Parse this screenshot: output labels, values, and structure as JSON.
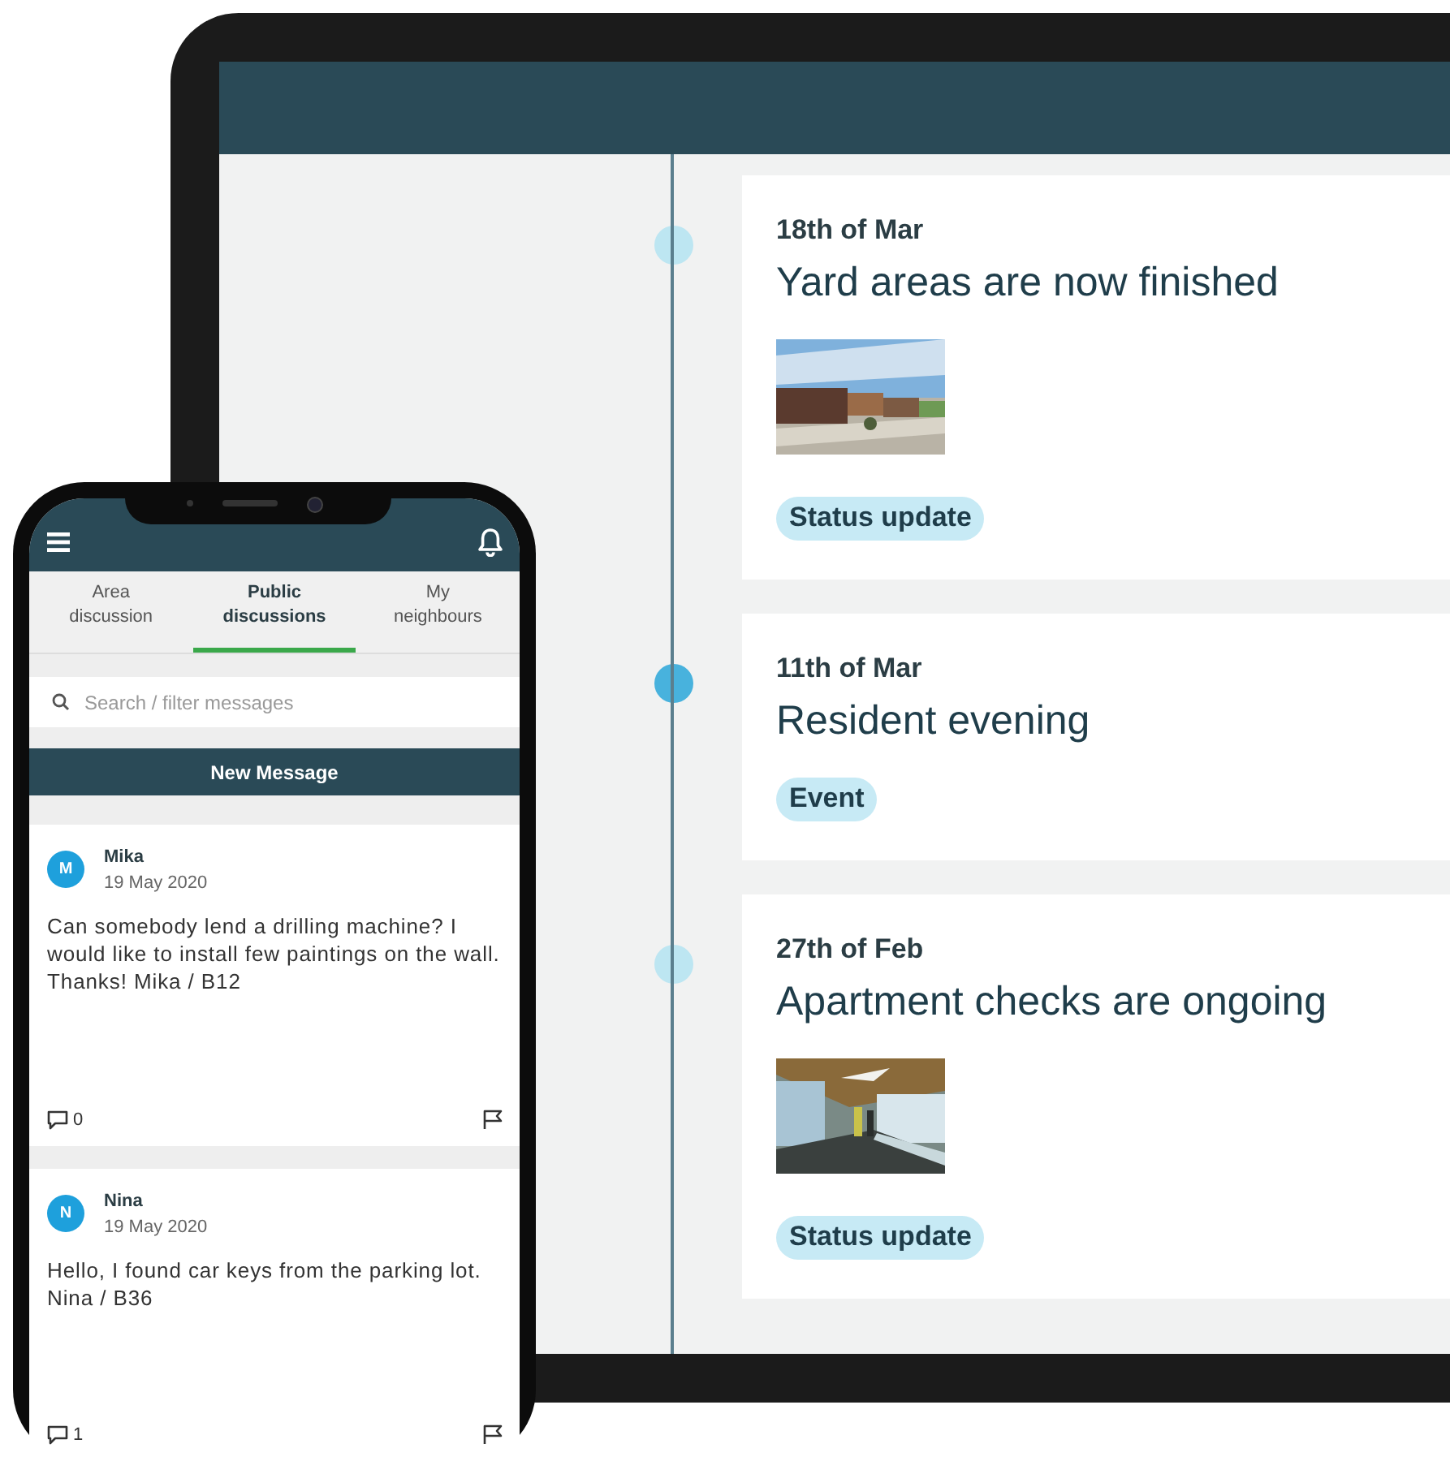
{
  "tablet": {
    "timeline": [
      {
        "date": "18th of Mar",
        "title": "Yard areas are now finished",
        "tag": "Status update",
        "highlighted": false
      },
      {
        "date": "11th of Mar",
        "title": "Resident evening",
        "tag": "Event",
        "highlighted": true
      },
      {
        "date": "27th of Feb",
        "title": "Apartment checks are ongoing",
        "tag": "Status update",
        "highlighted": false
      }
    ]
  },
  "phone": {
    "tabs": [
      {
        "label": "Area discussion",
        "selected": false
      },
      {
        "label": "Public discussions",
        "selected": true
      },
      {
        "label": "My neighbours",
        "selected": false
      }
    ],
    "search": {
      "placeholder": "Search / filter messages"
    },
    "new_message_button": "New Message",
    "messages": [
      {
        "initial": "M",
        "author": "Mika",
        "date": "19 May 2020",
        "text": "Can somebody lend a drilling machine? I would like to install few paintings on the wall. Thanks! Mika / B12",
        "comments": "0"
      },
      {
        "initial": "N",
        "author": "Nina",
        "date": "19 May 2020",
        "text": "Hello, I found car keys from the parking lot. Nina / B36",
        "comments": "1"
      }
    ]
  }
}
